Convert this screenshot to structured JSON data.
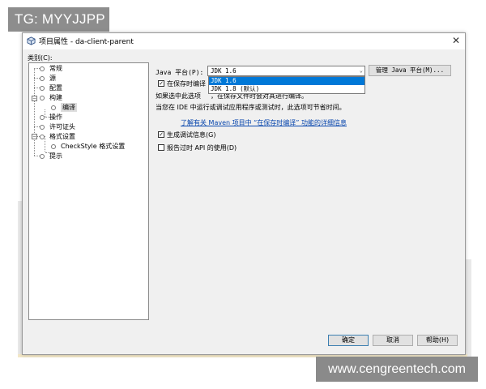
{
  "overlay": {
    "tag_text": "TG: MYYJJPP",
    "watermark_text": "www.cengreentech.com"
  },
  "dialog": {
    "title": "项目属性 - da-client-parent",
    "category_label": "类别(C):",
    "tree": [
      {
        "label": "常规"
      },
      {
        "label": "源"
      },
      {
        "label": "配置"
      },
      {
        "label": "构建"
      },
      {
        "label": "编译",
        "selected": true
      },
      {
        "label": "操作"
      },
      {
        "label": "许可证头"
      },
      {
        "label": "格式设置"
      },
      {
        "label": "CheckStyle 格式设置"
      },
      {
        "label": "提示"
      }
    ],
    "java_platform": {
      "label": "Java 平台(P):",
      "value": "JDK 1.6",
      "manage_button": "管理 Java 平台(M)...",
      "options": [
        "JDK 1.6",
        "JDK 1.8 (默认)"
      ]
    },
    "compile_on_save": {
      "label": "在保存时编译",
      "checked": true
    },
    "compile_on_save_suffix": "，在保存文件时会对其进行编译。",
    "info_line1": "如果选中此选项",
    "info_line2": "当您在 IDE 中运行或调试应用程序或测试时，此选项可节省时间。",
    "link_text": "了解有关 Maven 项目中 “在保存时编译” 功能的详细信息",
    "generate_debug": {
      "label": "生成调试信息(G)",
      "checked": true
    },
    "report_deprecated": {
      "label": "报告过时 API 的使用(D)",
      "checked": false
    },
    "buttons": {
      "ok": "确定",
      "cancel": "取消",
      "help": "帮助(H)"
    }
  }
}
